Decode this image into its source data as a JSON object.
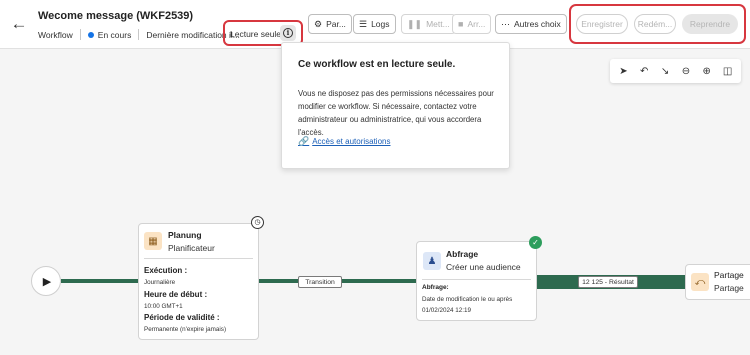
{
  "header": {
    "title": "Wecome message (WKF2539)",
    "type": "Workflow",
    "status": "En cours",
    "last_modified": "Dernière modification il...",
    "readonly_label": "Lecture seule",
    "back_icon": "back-arrow-icon",
    "info_icon": "info-icon"
  },
  "toolbar": {
    "params_label": "Par...",
    "logs_label": "Logs",
    "pause_label": "Mett...",
    "stop_label": "Arr...",
    "more_label": "Autres choix",
    "save_label": "Enregistrer",
    "restart_label": "Redém...",
    "resume_label": "Reprendre"
  },
  "popover": {
    "title": "Ce workflow est en lecture seule.",
    "body": "Vous ne disposez pas des permissions nécessaires pour modifier ce workflow. Si nécessaire, contactez votre administrateur ou administratrice, qui vous accordera l'accès.",
    "link": "Accès et autorisations"
  },
  "canvas_tools": [
    "pointer-icon",
    "undo-icon",
    "collapse-icon",
    "zoom-out-icon",
    "zoom-in-icon",
    "panel-icon"
  ],
  "workflow": {
    "scheduler": {
      "title": "Planung",
      "subtitle": "Planificateur",
      "execution_label": "Exécution :",
      "execution_value": "Journalière",
      "start_label": "Heure de début :",
      "start_value": "10:00 GMT+1",
      "validity_label": "Période de validité :",
      "validity_value": "Permanente (n'expire jamais)"
    },
    "transition_label": "Transition",
    "query": {
      "title": "Abfrage",
      "subtitle": "Créer une audience",
      "detail_label": "Abfrage:",
      "detail_line1": "Date de modification le ou après",
      "detail_line2": "01/02/2024 12:19"
    },
    "result_label": "12 125 - Résultat",
    "share": {
      "title": "Partage",
      "subtitle": "Partage"
    }
  },
  "colors": {
    "accent_blue": "#1473e6",
    "highlight_red": "#d7373f",
    "flow_green": "#2d6a4f",
    "success_green": "#2d9d5c"
  }
}
